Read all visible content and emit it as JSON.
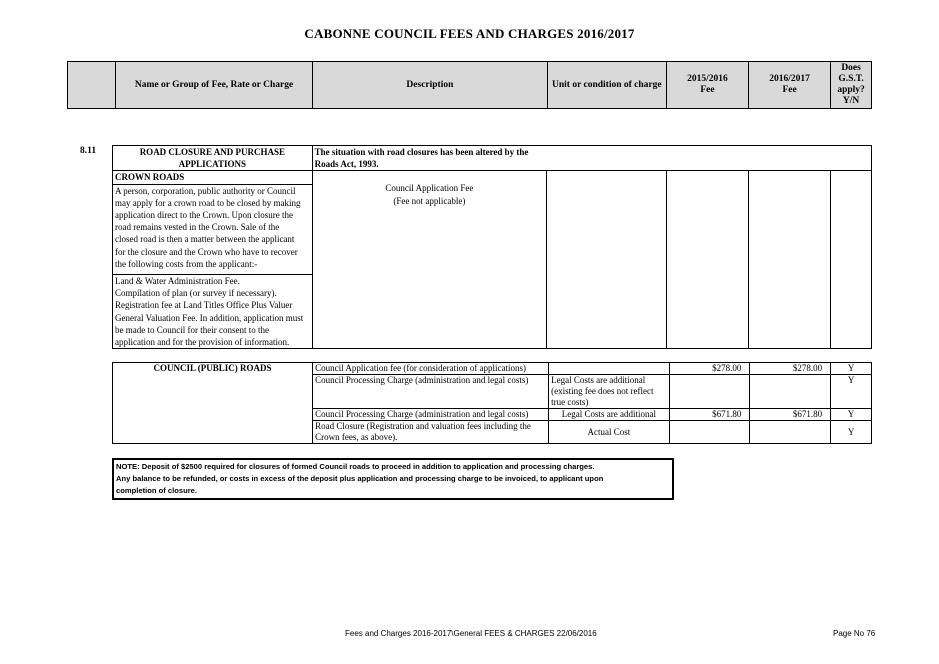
{
  "title": "CABONNE COUNCIL FEES AND CHARGES 2016/2017",
  "header": {
    "name_col": "Name or Group of Fee, Rate or Charge",
    "desc_col": "Description",
    "unit_col": "Unit or condition of charge",
    "fee2015_l1": "2015/2016",
    "fee2015_l2": "Fee",
    "fee2016_l1": "2016/2017",
    "fee2016_l2": "Fee",
    "gst_l1": "Does",
    "gst_l2": "G.S.T.",
    "gst_l3": "apply?",
    "gst_l4": "Y/N"
  },
  "section": {
    "number": "8.11",
    "name_l1": "ROAD CLOSURE AND PURCHASE",
    "name_l2": "APPLICATIONS",
    "desc_l1": "The situation with road closures has been altered by the",
    "desc_l2": "Roads Act, 1993.",
    "crown_heading": "CROWN ROADS",
    "crown_para1": [
      "A person, corporation, public authority or Council",
      "may apply for a crown road to be closed by making",
      "application direct to the Crown. Upon closure the",
      "road remains vested in the Crown. Sale of the",
      "closed road is then a matter between the applicant",
      "for the closure and the Crown who have to recover",
      "the following costs from the applicant:-"
    ],
    "crown_para2": [
      "Land & Water Administration Fee.",
      "Compilation of plan (or survey if necessary).",
      "Registration fee at Land Titles Office Plus Valuer",
      "General Valuation Fee. In addition, application must",
      "be made to Council for their consent to the",
      "application and for the provision of information."
    ],
    "crown_desc_l1": "Council Application Fee",
    "crown_desc_l2": "(Fee not applicable)"
  },
  "council_roads": {
    "heading": "COUNCIL (PUBLIC) ROADS",
    "rows": [
      {
        "desc": "Council Application fee (for consideration of applications)",
        "unit": "",
        "fee2015": "$278.00",
        "fee2016": "$278.00",
        "gst": "Y"
      },
      {
        "desc": "Council Processing Charge (administration and legal costs)",
        "unit_l1": "Legal Costs are additional",
        "unit_l2": "(existing fee does not reflect",
        "unit_l3": "true costs)",
        "fee2015": "",
        "fee2016": "",
        "gst": "Y"
      },
      {
        "desc": "Council Processing Charge (administration and legal costs)",
        "unit": "Legal Costs are additional",
        "fee2015": "$671.80",
        "fee2016": "$671.80",
        "gst": "Y"
      },
      {
        "desc_l1": "Road Closure (Registration and valuation fees including the",
        "desc_l2": "Crown fees, as above).",
        "unit": "Actual Cost",
        "fee2015": "",
        "fee2016": "",
        "gst": "Y"
      }
    ]
  },
  "note": {
    "l1": "NOTE: Deposit of $2500 required for closures of formed Council roads to proceed in addition to application and processing charges.",
    "l2": "Any balance to be refunded, or costs in excess of the deposit plus application and processing charge to be invoiced, to applicant upon",
    "l3": "completion of closure."
  },
  "footer": {
    "file": "Fees and Charges 2016-2017\\General FEES & CHARGES 22/06/2016",
    "page": "Page No 76"
  }
}
